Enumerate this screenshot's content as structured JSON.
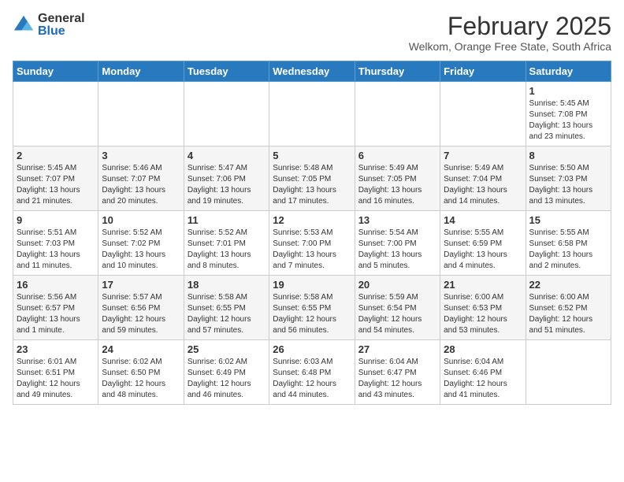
{
  "logo": {
    "general": "General",
    "blue": "Blue"
  },
  "header": {
    "month_year": "February 2025",
    "location": "Welkom, Orange Free State, South Africa"
  },
  "weekdays": [
    "Sunday",
    "Monday",
    "Tuesday",
    "Wednesday",
    "Thursday",
    "Friday",
    "Saturday"
  ],
  "weeks": [
    [
      {
        "day": "",
        "info": ""
      },
      {
        "day": "",
        "info": ""
      },
      {
        "day": "",
        "info": ""
      },
      {
        "day": "",
        "info": ""
      },
      {
        "day": "",
        "info": ""
      },
      {
        "day": "",
        "info": ""
      },
      {
        "day": "1",
        "info": "Sunrise: 5:45 AM\nSunset: 7:08 PM\nDaylight: 13 hours\nand 23 minutes."
      }
    ],
    [
      {
        "day": "2",
        "info": "Sunrise: 5:45 AM\nSunset: 7:07 PM\nDaylight: 13 hours\nand 21 minutes."
      },
      {
        "day": "3",
        "info": "Sunrise: 5:46 AM\nSunset: 7:07 PM\nDaylight: 13 hours\nand 20 minutes."
      },
      {
        "day": "4",
        "info": "Sunrise: 5:47 AM\nSunset: 7:06 PM\nDaylight: 13 hours\nand 19 minutes."
      },
      {
        "day": "5",
        "info": "Sunrise: 5:48 AM\nSunset: 7:05 PM\nDaylight: 13 hours\nand 17 minutes."
      },
      {
        "day": "6",
        "info": "Sunrise: 5:49 AM\nSunset: 7:05 PM\nDaylight: 13 hours\nand 16 minutes."
      },
      {
        "day": "7",
        "info": "Sunrise: 5:49 AM\nSunset: 7:04 PM\nDaylight: 13 hours\nand 14 minutes."
      },
      {
        "day": "8",
        "info": "Sunrise: 5:50 AM\nSunset: 7:03 PM\nDaylight: 13 hours\nand 13 minutes."
      }
    ],
    [
      {
        "day": "9",
        "info": "Sunrise: 5:51 AM\nSunset: 7:03 PM\nDaylight: 13 hours\nand 11 minutes."
      },
      {
        "day": "10",
        "info": "Sunrise: 5:52 AM\nSunset: 7:02 PM\nDaylight: 13 hours\nand 10 minutes."
      },
      {
        "day": "11",
        "info": "Sunrise: 5:52 AM\nSunset: 7:01 PM\nDaylight: 13 hours\nand 8 minutes."
      },
      {
        "day": "12",
        "info": "Sunrise: 5:53 AM\nSunset: 7:00 PM\nDaylight: 13 hours\nand 7 minutes."
      },
      {
        "day": "13",
        "info": "Sunrise: 5:54 AM\nSunset: 7:00 PM\nDaylight: 13 hours\nand 5 minutes."
      },
      {
        "day": "14",
        "info": "Sunrise: 5:55 AM\nSunset: 6:59 PM\nDaylight: 13 hours\nand 4 minutes."
      },
      {
        "day": "15",
        "info": "Sunrise: 5:55 AM\nSunset: 6:58 PM\nDaylight: 13 hours\nand 2 minutes."
      }
    ],
    [
      {
        "day": "16",
        "info": "Sunrise: 5:56 AM\nSunset: 6:57 PM\nDaylight: 13 hours\nand 1 minute."
      },
      {
        "day": "17",
        "info": "Sunrise: 5:57 AM\nSunset: 6:56 PM\nDaylight: 12 hours\nand 59 minutes."
      },
      {
        "day": "18",
        "info": "Sunrise: 5:58 AM\nSunset: 6:55 PM\nDaylight: 12 hours\nand 57 minutes."
      },
      {
        "day": "19",
        "info": "Sunrise: 5:58 AM\nSunset: 6:55 PM\nDaylight: 12 hours\nand 56 minutes."
      },
      {
        "day": "20",
        "info": "Sunrise: 5:59 AM\nSunset: 6:54 PM\nDaylight: 12 hours\nand 54 minutes."
      },
      {
        "day": "21",
        "info": "Sunrise: 6:00 AM\nSunset: 6:53 PM\nDaylight: 12 hours\nand 53 minutes."
      },
      {
        "day": "22",
        "info": "Sunrise: 6:00 AM\nSunset: 6:52 PM\nDaylight: 12 hours\nand 51 minutes."
      }
    ],
    [
      {
        "day": "23",
        "info": "Sunrise: 6:01 AM\nSunset: 6:51 PM\nDaylight: 12 hours\nand 49 minutes."
      },
      {
        "day": "24",
        "info": "Sunrise: 6:02 AM\nSunset: 6:50 PM\nDaylight: 12 hours\nand 48 minutes."
      },
      {
        "day": "25",
        "info": "Sunrise: 6:02 AM\nSunset: 6:49 PM\nDaylight: 12 hours\nand 46 minutes."
      },
      {
        "day": "26",
        "info": "Sunrise: 6:03 AM\nSunset: 6:48 PM\nDaylight: 12 hours\nand 44 minutes."
      },
      {
        "day": "27",
        "info": "Sunrise: 6:04 AM\nSunset: 6:47 PM\nDaylight: 12 hours\nand 43 minutes."
      },
      {
        "day": "28",
        "info": "Sunrise: 6:04 AM\nSunset: 6:46 PM\nDaylight: 12 hours\nand 41 minutes."
      },
      {
        "day": "",
        "info": ""
      }
    ]
  ]
}
